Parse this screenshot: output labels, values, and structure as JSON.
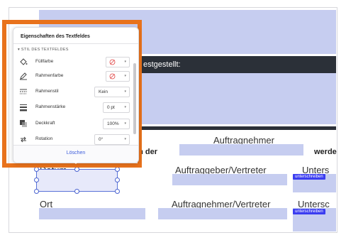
{
  "document": {
    "header_fragment": "estgestellt:",
    "contractor_label": "Auftragnehmer",
    "bold_left": "rgen der",
    "bold_right": "werde",
    "date_label": "Datum",
    "client_rep_label": "Auftraggeber/Vertreter",
    "sign_fragment_1": "Unters",
    "place_label": "Ort",
    "contractor_rep_label": "Auftragnehmer/Vertreter",
    "sign_fragment_2": "Untersc",
    "sign_badge": "unterschreiben"
  },
  "panel": {
    "title": "Eigenschaften des Textfeldes",
    "section": "STIL DES TEXTFELDES",
    "rows": [
      {
        "label": "Füllfarbe",
        "value": "",
        "icon": "paint-bucket-icon"
      },
      {
        "label": "Rahmenfarbe",
        "value": "",
        "icon": "pen-border-icon"
      },
      {
        "label": "Rahmenstil",
        "value": "Kein",
        "icon": "border-style-icon"
      },
      {
        "label": "Rahmenstärke",
        "value": "0 pt",
        "icon": "border-width-icon"
      },
      {
        "label": "Deckkraft",
        "value": "100%",
        "icon": "opacity-icon"
      },
      {
        "label": "Rotation",
        "value": "0°",
        "icon": "rotate-icon"
      }
    ],
    "delete_label": "Löschen"
  },
  "colors": {
    "accent_orange": "#e8721c",
    "field_blue": "#c6cdf0",
    "dark_bar": "#2b3038",
    "badge_blue": "#3b3df0",
    "link_blue": "#3b5bdb"
  }
}
